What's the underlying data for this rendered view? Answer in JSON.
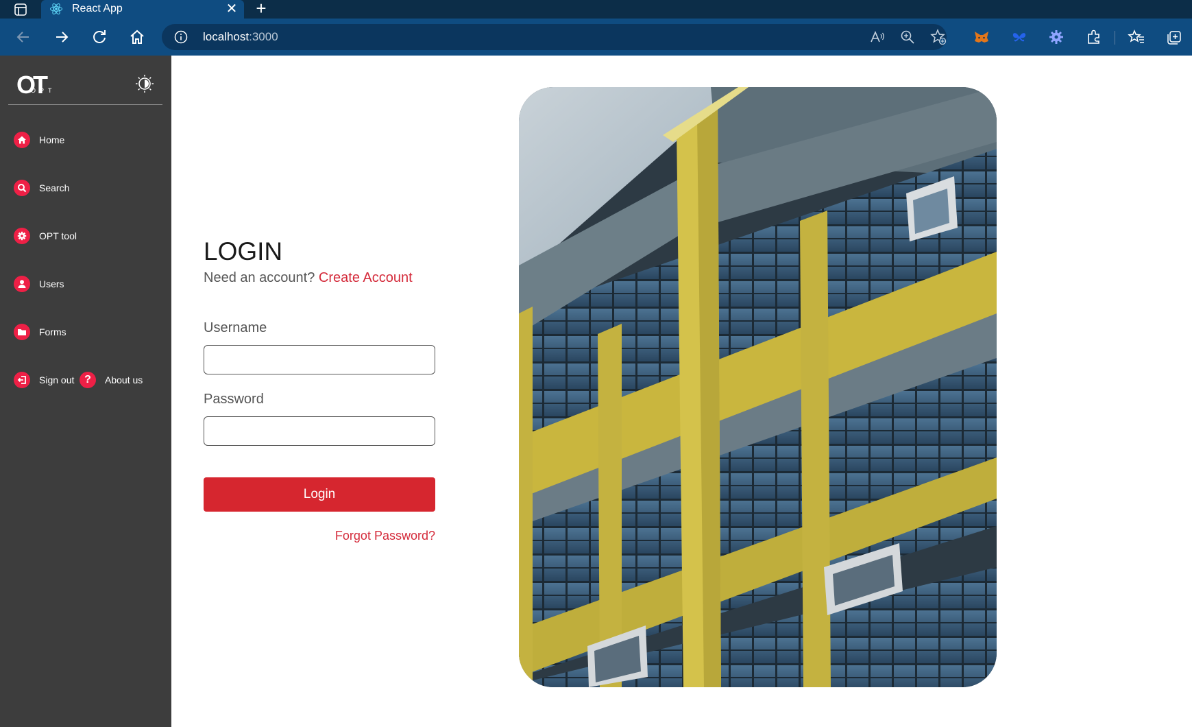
{
  "browser": {
    "tab_title": "React App",
    "url_host": "localhost",
    "url_port": ":3000"
  },
  "sidebar": {
    "logo_mark": "OT",
    "logo_sub": "OPT",
    "items": [
      {
        "label": "Home",
        "icon": "home-icon"
      },
      {
        "label": "Search",
        "icon": "search-icon"
      },
      {
        "label": "OPT tool",
        "icon": "gear-icon"
      },
      {
        "label": "Users",
        "icon": "user-icon"
      },
      {
        "label": "Forms",
        "icon": "folder-icon"
      },
      {
        "label": "Sign out",
        "icon": "sign-out-icon"
      }
    ],
    "about": {
      "label": "About us",
      "icon_glyph": "?"
    }
  },
  "login": {
    "title": "LOGIN",
    "account_prompt": "Need an account?",
    "create_account_link": "Create Account",
    "username_label": "Username",
    "username_value": "",
    "password_label": "Password",
    "password_value": "",
    "login_button": "Login",
    "forgot_password_link": "Forgot Password?"
  },
  "colors": {
    "accent": "#d6262f",
    "sidebar_bg": "#3d3d3d",
    "nav_icon_bg": "#ee2046",
    "browser_chrome": "#0f4c81"
  }
}
